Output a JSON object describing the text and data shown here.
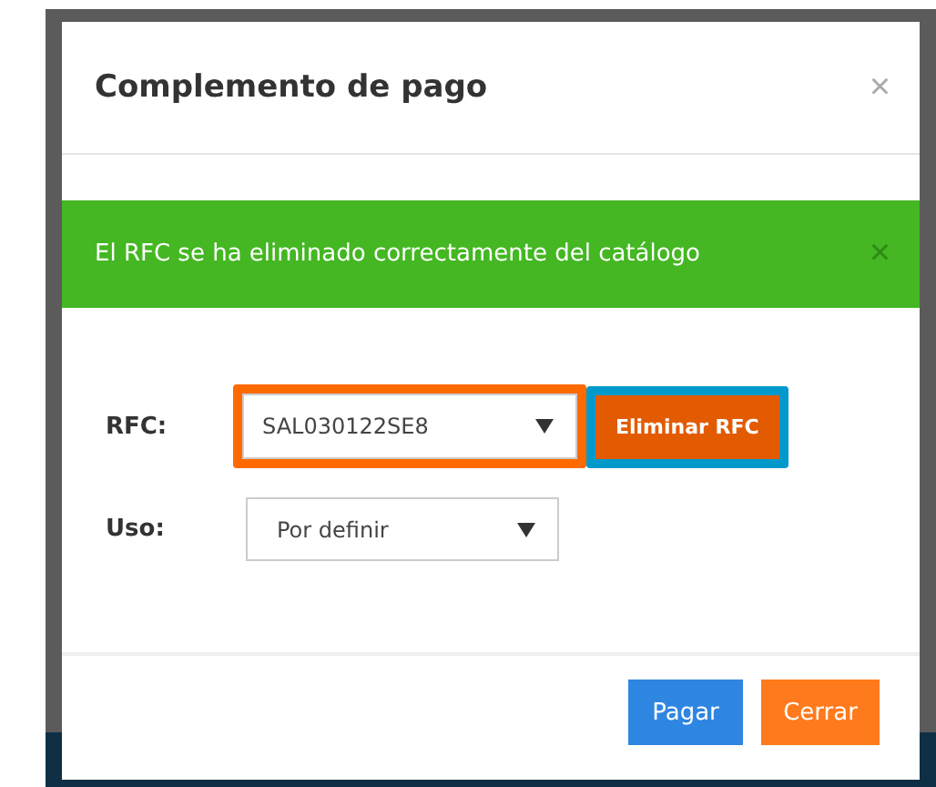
{
  "modal": {
    "title": "Complemento de pago",
    "close": "×"
  },
  "alert": {
    "message": "El RFC se ha eliminado correctamente del catálogo",
    "close": "×"
  },
  "form": {
    "rfc": {
      "label": "RFC:",
      "value": "SAL030122SE8",
      "color": "#ff6a00"
    },
    "delete_button": {
      "label": "Eliminar RFC",
      "color": "#0099cc"
    },
    "uso": {
      "label": "Uso:",
      "value": "Por definir"
    }
  },
  "buttons": [
    {
      "label": "Pagar",
      "kind": "primary"
    },
    {
      "label": "Cerrar",
      "kind": "warning"
    }
  ]
}
